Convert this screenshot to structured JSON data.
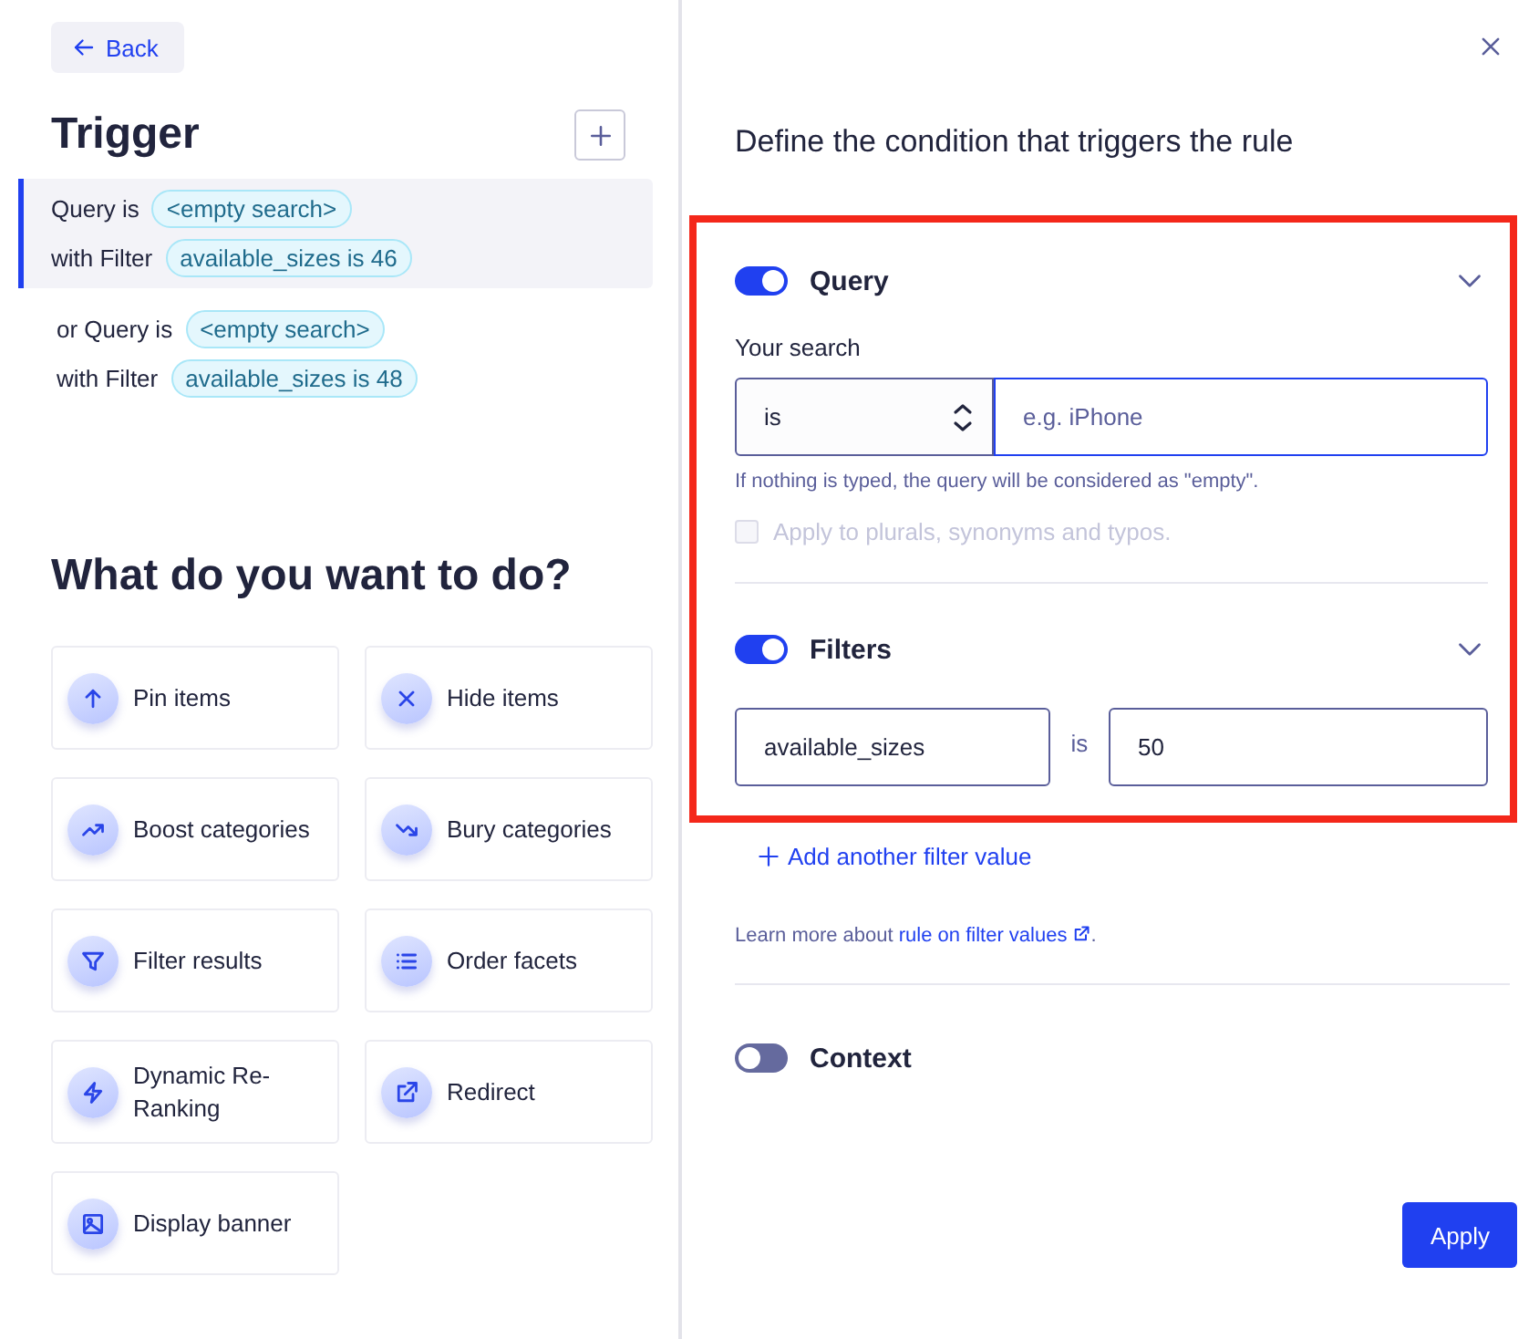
{
  "back_button": "Back",
  "trigger": {
    "title": "Trigger",
    "conditions": [
      {
        "selected": true,
        "query_label": "Query is",
        "query_chip": "<empty search>",
        "filter_label": "with Filter",
        "filter_chip": "available_sizes is 46"
      },
      {
        "selected": false,
        "query_label": "or Query is",
        "query_chip": "<empty search>",
        "filter_label": "with Filter",
        "filter_chip": "available_sizes is 48"
      }
    ]
  },
  "actions": {
    "title": "What do you want to do?",
    "items": [
      {
        "label": "Pin items",
        "kind": "pin"
      },
      {
        "label": "Hide items",
        "kind": "hide"
      },
      {
        "label": "Boost categories",
        "kind": "boost"
      },
      {
        "label": "Bury categories",
        "kind": "bury"
      },
      {
        "label": "Filter results",
        "kind": "filter"
      },
      {
        "label": "Order facets",
        "kind": "order"
      },
      {
        "label": "Dynamic Re-Ranking",
        "kind": "rerank"
      },
      {
        "label": "Redirect",
        "kind": "redirect"
      },
      {
        "label": "Display banner",
        "kind": "banner"
      }
    ]
  },
  "panel": {
    "title": "Define the condition that triggers the rule",
    "highlighted": true,
    "query": {
      "label": "Query",
      "on": true,
      "expanded": true,
      "search_label": "Your search",
      "operator": "is",
      "placeholder": "e.g. iPhone",
      "hint": "If nothing is typed, the query will be considered as \"empty\".",
      "option": {
        "label": "Apply to plurals, synonyms and typos.",
        "checked": false,
        "disabled": true
      }
    },
    "filters": {
      "label": "Filters",
      "on": true,
      "expanded": true,
      "attribute": "available_sizes",
      "operator": "is",
      "value": "50"
    },
    "add_link": "Add another filter value",
    "note": {
      "text": "Learn more about",
      "link": "rule on filter values",
      "end": "."
    },
    "context": {
      "label": "Context",
      "on": false
    },
    "apply_button": "Apply"
  }
}
